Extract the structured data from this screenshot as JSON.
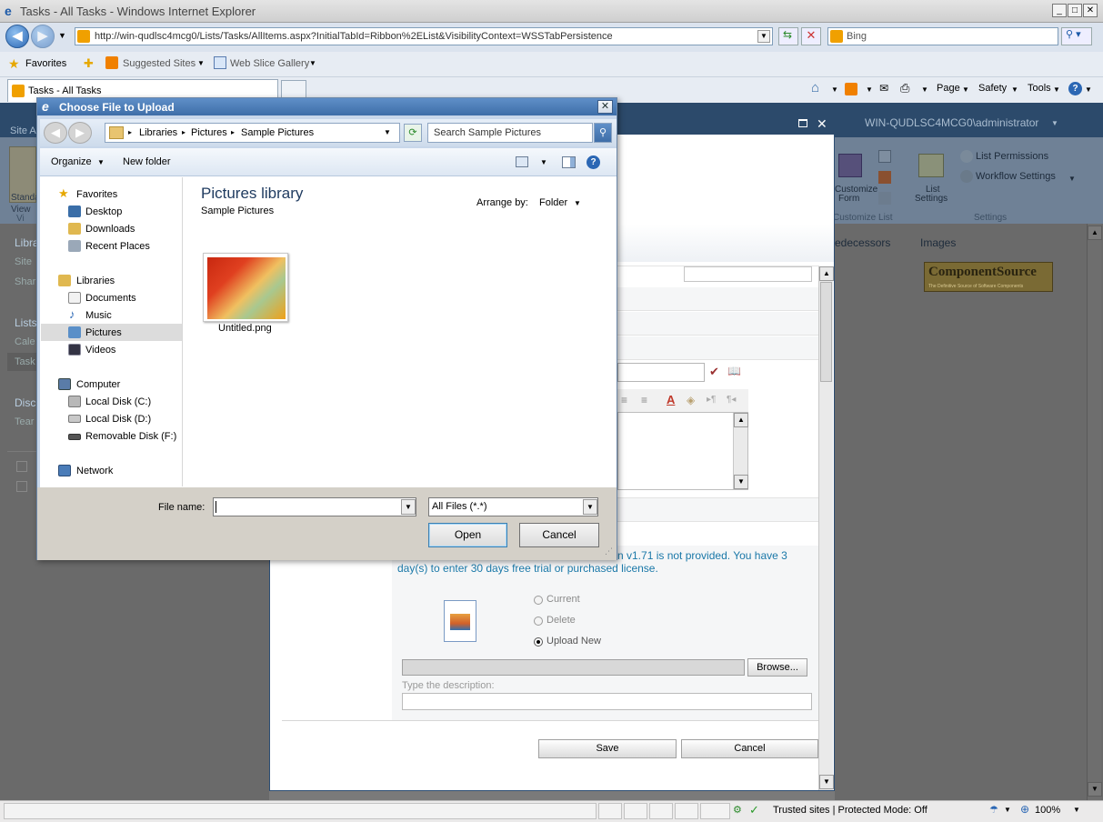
{
  "browser": {
    "title": "Tasks - All Tasks - Windows Internet Explorer",
    "address": "http://win-qudlsc4mcg0/Lists/Tasks/AllItems.aspx?InitialTabId=Ribbon%2EList&VisibilityContext=WSSTabPersistence",
    "search_placeholder": "Bing",
    "favorites_label": "Favorites",
    "suggested_sites": "Suggested Sites",
    "web_slice_gallery": "Web Slice Gallery",
    "tab_label": "Tasks - All Tasks",
    "commands": {
      "page": "Page",
      "safety": "Safety",
      "tools": "Tools"
    }
  },
  "sharepoint": {
    "user": "WIN-QUDLSC4MCG0\\administrator",
    "site_actions": "Site A",
    "ribbon": {
      "list_permissions": "List Permissions",
      "workflow_settings": "Workflow Settings",
      "customize_form_1": "Customize",
      "customize_form_2": "Form",
      "list_settings_1": "List",
      "list_settings_2": "Settings",
      "customize_list_group": "Customize List",
      "settings_group": "Settings",
      "standard_view_1": "Standa",
      "standard_view_2": "View",
      "view_group": "Vi"
    },
    "left_nav": {
      "libraries": "Libra",
      "site": "Site",
      "shared": "Shar",
      "lists": "Lists",
      "calendar": "Cale",
      "tasks": "Task",
      "discussions": "Disc",
      "team": "Tear"
    },
    "columns": {
      "predecessors": "edecessors",
      "images": "Images"
    },
    "logo_text": "ComponentSource",
    "logo_sub": "The Definitive Source of Software Components"
  },
  "form": {
    "license_msg_1": "n v1.71 is not provided. You have 3",
    "license_msg_2": "day(s) to enter 30 days free trial or purchased license.",
    "radio_current": "Current",
    "radio_delete": "Delete",
    "radio_upload": "Upload New",
    "browse": "Browse...",
    "desc_label": "Type the description:",
    "save": "Save",
    "cancel": "Cancel"
  },
  "dialog": {
    "title": "Choose File to Upload",
    "breadcrumb": [
      "Libraries",
      "Pictures",
      "Sample Pictures"
    ],
    "search_placeholder": "Search Sample Pictures",
    "organize": "Organize",
    "new_folder": "New folder",
    "library_title": "Pictures library",
    "library_sub": "Sample Pictures",
    "arrange_by": "Arrange by:",
    "arrange_value": "Folder",
    "file_name": "Untitled.png",
    "file_name_label": "File name:",
    "file_type": "All Files (*.*)",
    "open": "Open",
    "cancel": "Cancel",
    "nav": {
      "favorites": "Favorites",
      "desktop": "Desktop",
      "downloads": "Downloads",
      "recent_places": "Recent Places",
      "libraries": "Libraries",
      "documents": "Documents",
      "music": "Music",
      "pictures": "Pictures",
      "videos": "Videos",
      "computer": "Computer",
      "local_c": "Local Disk (C:)",
      "local_d": "Local Disk (D:)",
      "removable_f": "Removable Disk (F:)",
      "network": "Network"
    }
  },
  "status": {
    "zone": "Trusted sites | Protected Mode: Off",
    "zoom": "100%"
  },
  "colors": {
    "sp_dark": "#2c4a6b",
    "accent_blue": "#1a78a8",
    "dialog_title": "#3e6ea8"
  }
}
